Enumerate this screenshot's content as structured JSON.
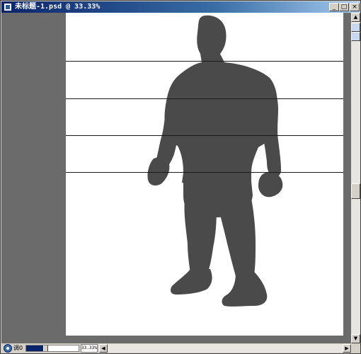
{
  "window": {
    "title": "未标题-1.psd @ 33.33%",
    "title_icon": "photoshop-document-icon",
    "controls": {
      "minimize_glyph": "_",
      "maximize_glyph": "□",
      "close_glyph": "×"
    }
  },
  "canvas": {
    "background_color": "#6b6b6b",
    "document_color": "#ffffff",
    "figure_color": "#4a4a4a",
    "guide_count": 4
  },
  "scrollbar": {
    "up_glyph": "▲",
    "down_glyph": "▼",
    "left_glyph": "◀",
    "right_glyph": "▶"
  },
  "statusbar": {
    "icon": "info-icon",
    "label": "调0",
    "zoom_value": "33.33%",
    "zoom_level": 0.33
  },
  "colors": {
    "title_active": "#0a246a",
    "chrome": "#d4d0c8"
  }
}
